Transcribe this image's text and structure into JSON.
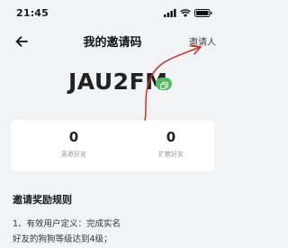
{
  "status_bar": {
    "time": "21:45",
    "icons": [
      "signal-icon",
      "wifi-icon",
      "battery-icon"
    ]
  },
  "nav": {
    "back_icon": "arrow-left-icon",
    "title": "我的邀请码",
    "action_label": "邀请人"
  },
  "invite": {
    "code": "JAU2FM",
    "copy_icon": "copy-icon",
    "badge_color": "#56bb64"
  },
  "stats": [
    {
      "value": "0",
      "label": "直邀好友"
    },
    {
      "value": "0",
      "label": "扩散好友"
    }
  ],
  "rules": {
    "title": "邀请奖励规则",
    "lines": [
      "1、有效用户定义：完成实名",
      "好友的狗狗等级达到4级；"
    ]
  },
  "colors": {
    "background": "#f2f3f5",
    "card": "#ffffff",
    "annotation": "#c8322a"
  }
}
